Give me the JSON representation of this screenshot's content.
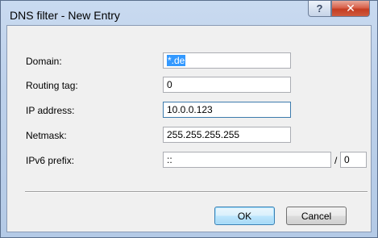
{
  "window": {
    "title": "DNS filter - New Entry",
    "help_glyph": "?",
    "close_glyph": "✕"
  },
  "form": {
    "domain": {
      "label": "Domain:",
      "value": "*.de"
    },
    "routing_tag": {
      "label": "Routing tag:",
      "value": "0"
    },
    "ip_address": {
      "label": "IP address:",
      "value": "10.0.0.123"
    },
    "netmask": {
      "label": "Netmask:",
      "value": "255.255.255.255"
    },
    "ipv6_prefix": {
      "label": "IPv6 prefix:",
      "value": "::",
      "separator": "/",
      "length": "0"
    }
  },
  "buttons": {
    "ok": "OK",
    "cancel": "Cancel"
  }
}
